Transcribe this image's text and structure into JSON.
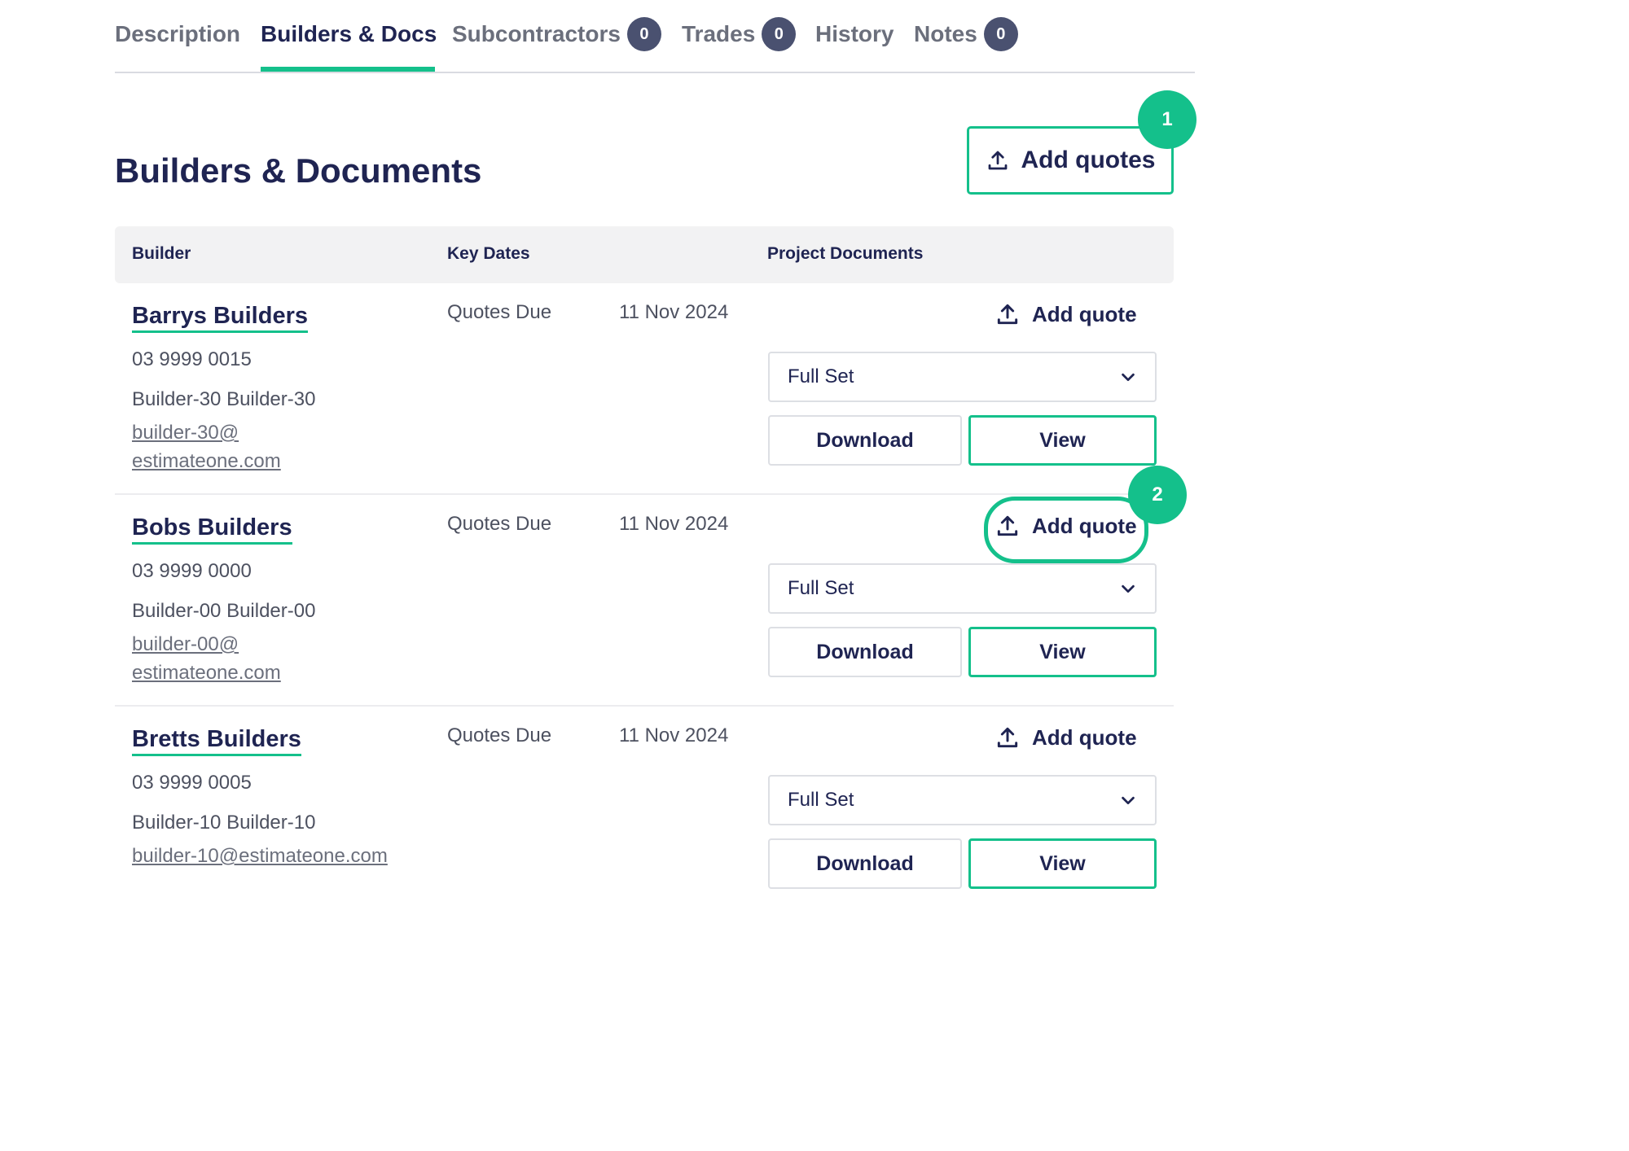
{
  "tabs": [
    {
      "label": "Description",
      "active": false
    },
    {
      "label": "Builders & Docs",
      "active": true
    },
    {
      "label": "Subcontractors",
      "count": "0"
    },
    {
      "label": "Trades",
      "count": "0"
    },
    {
      "label": "History"
    },
    {
      "label": "Notes",
      "count": "0"
    }
  ],
  "page": {
    "title": "Builders & Documents",
    "add_quotes_label": "Add quotes"
  },
  "callouts": {
    "first": "1",
    "second": "2"
  },
  "table": {
    "headers": {
      "builder": "Builder",
      "key_dates": "Key Dates",
      "project_documents": "Project Documents"
    },
    "rows": [
      {
        "name": "Barrys Builders",
        "phone": "03 9999 0015",
        "contact": "Builder-30 Builder-30",
        "email_line1": "builder-30@",
        "email_line2": "estimateone.com",
        "key_date_label": "Quotes Due",
        "key_date": "11 Nov 2024",
        "add_quote_label": "Add quote",
        "doc_set": "Full Set",
        "download_label": "Download",
        "view_label": "View"
      },
      {
        "name": "Bobs Builders",
        "phone": "03 9999 0000",
        "contact": "Builder-00 Builder-00",
        "email_line1": "builder-00@",
        "email_line2": "estimateone.com",
        "key_date_label": "Quotes Due",
        "key_date": "11 Nov 2024",
        "add_quote_label": "Add quote",
        "doc_set": "Full Set",
        "download_label": "Download",
        "view_label": "View"
      },
      {
        "name": "Bretts Builders",
        "phone": "03 9999 0005",
        "contact": "Builder-10 Builder-10",
        "email": "builder-10@estimateone.com",
        "key_date_label": "Quotes Due",
        "key_date": "11 Nov 2024",
        "add_quote_label": "Add quote",
        "doc_set": "Full Set",
        "download_label": "Download",
        "view_label": "View"
      }
    ]
  },
  "colors": {
    "accent": "#14c08b",
    "navy": "#1f2452",
    "badge": "#4a5170",
    "muted_text": "#4d5160",
    "header_bg": "#f2f2f3"
  },
  "icons": {
    "upload": "upload-icon",
    "chevron": "chevron-down-icon"
  }
}
